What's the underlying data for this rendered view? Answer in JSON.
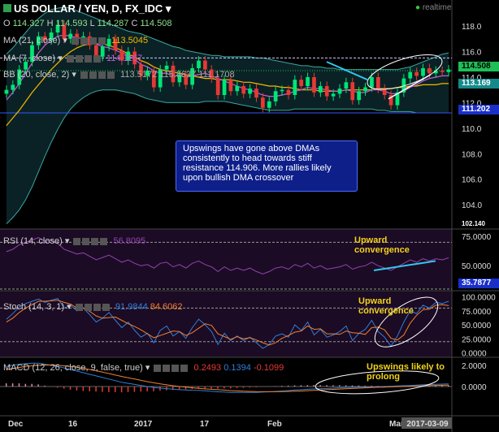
{
  "header": {
    "symbol": "US DOLLAR / YEN, D, FX_IDC",
    "realtime": "realtime",
    "ohlc": {
      "o_label": "O",
      "o": "114.327",
      "h_label": "H",
      "h": "114.593",
      "l_label": "L",
      "l": "114.287",
      "c_label": "C",
      "c": "114.508"
    },
    "ma21_label": "MA (21, close)",
    "ma21_value": "113.5045",
    "ma7_label": "MA (7, close)",
    "ma7_value": "114.1167",
    "bb_label": "BB (20, close, 2)",
    "bb_values": [
      "113.5172",
      "115.8637",
      "111.1708"
    ],
    "rsi_label": "RSI (14, close)",
    "rsi_value": "56.8095",
    "stoch_label": "Stoch (14, 3, 1)",
    "stoch_values": [
      "91.9844",
      "84.6062"
    ],
    "macd_label": "MACD (12, 26, close, 9, false, true)",
    "macd_values": [
      "0.2493",
      "0.1394",
      "-0.1099"
    ]
  },
  "callout": "Upswings have gone above DMAs consistently to head towards stiff resistance 114.906. More rallies likely upon bullish DMA crossover",
  "annotations": {
    "rsi": [
      "Upward",
      "convergence"
    ],
    "stoch": [
      "Upward",
      "convergence"
    ],
    "macd": [
      "Upswings likely to",
      "prolong"
    ]
  },
  "price_tags": {
    "last": "114.508",
    "bb_mid": "113.169",
    "support": "111.202",
    "upper_rsi": "35.7877",
    "top_cut": "102.140"
  },
  "colors": {
    "up": "#00e676",
    "down": "#e53935",
    "ma21": "#f5b800",
    "ma7": "#c85ad8",
    "bb": "#3aa6a0",
    "rsi": "#8e44ad",
    "stoch_k": "#2f7fd8",
    "stoch_d": "#f08030",
    "macd": "#2f7fd8",
    "signal": "#f08030",
    "callout_bg": "#0e1f8a",
    "annotation": "#f2d21b",
    "arrow": "#30c8f0"
  },
  "chart_data": [
    {
      "type": "candlestick",
      "title": "US DOLLAR / YEN, D, FX_IDC",
      "ylim": [
        102.1,
        118.9
      ],
      "yticks": [
        118.0,
        116.0,
        114.0,
        112.0,
        110.0,
        108.0,
        106.0,
        104.0
      ],
      "xticks": [
        "Dec",
        "16",
        "2017",
        "17",
        "Feb",
        "Mar",
        "2017-03-09"
      ],
      "close": [
        113.0,
        113.4,
        114.6,
        115.2,
        116.5,
        117.2,
        116.9,
        117.5,
        118.1,
        117.0,
        117.4,
        116.8,
        117.2,
        116.5,
        115.6,
        116.4,
        117.0,
        116.1,
        115.3,
        116.0,
        115.0,
        114.1,
        114.5,
        113.2,
        114.6,
        114.9,
        113.6,
        114.2,
        113.4,
        114.7,
        115.3,
        114.6,
        113.9,
        112.6,
        113.8,
        112.9,
        113.3,
        112.7,
        113.1,
        112.4,
        111.6,
        112.1,
        112.9,
        113.0,
        112.6,
        113.8,
        113.3,
        114.0,
        112.8,
        113.3,
        112.5,
        112.7,
        113.1,
        113.6,
        112.2,
        112.9,
        113.2,
        114.0,
        113.1,
        112.6,
        111.8,
        112.8,
        113.9,
        114.4,
        114.1,
        114.7,
        114.3,
        114.5,
        114.4,
        114.6
      ],
      "ma21": [
        110.2,
        110.8,
        111.4,
        112.1,
        112.8,
        113.4,
        114.0,
        114.6,
        115.1,
        115.6,
        116.0,
        116.3,
        116.5,
        116.6,
        116.6,
        116.6,
        116.5,
        116.3,
        116.1,
        115.8,
        115.6,
        115.3,
        115.1,
        114.8,
        114.6,
        114.5,
        114.4,
        114.3,
        114.2,
        114.1,
        114.0,
        113.9,
        113.9,
        113.8,
        113.8,
        113.8,
        113.7,
        113.6,
        113.6,
        113.5,
        113.4,
        113.3,
        113.3,
        113.2,
        113.2,
        113.1,
        113.0,
        113.0,
        113.0,
        112.9,
        112.9,
        112.9,
        112.9,
        113.0,
        113.0,
        113.0,
        113.0,
        113.0,
        113.1,
        113.1,
        113.1,
        113.2,
        113.2,
        113.3,
        113.3,
        113.4,
        113.4,
        113.4,
        113.5,
        113.5
      ],
      "ma7": [
        112.2,
        112.8,
        113.5,
        114.3,
        115.1,
        115.9,
        116.5,
        116.9,
        117.2,
        117.3,
        117.2,
        117.1,
        117.0,
        116.9,
        116.6,
        116.4,
        116.3,
        116.1,
        115.9,
        115.7,
        115.4,
        115.0,
        114.8,
        114.5,
        114.3,
        114.3,
        114.1,
        114.1,
        114.0,
        114.1,
        114.2,
        114.3,
        114.1,
        113.9,
        113.7,
        113.5,
        113.3,
        113.1,
        113.0,
        112.8,
        112.6,
        112.5,
        112.5,
        112.6,
        112.7,
        112.9,
        113.0,
        113.2,
        113.1,
        113.1,
        113.0,
        112.9,
        112.9,
        113.0,
        112.9,
        112.8,
        112.8,
        113.0,
        113.0,
        112.9,
        112.7,
        112.7,
        112.9,
        113.2,
        113.4,
        113.7,
        113.9,
        114.0,
        114.1,
        114.1
      ],
      "bb_upper": [
        115.8,
        116.3,
        116.9,
        117.5,
        118.1,
        118.6,
        119.0,
        119.3,
        119.4,
        119.5,
        119.4,
        119.2,
        119.0,
        118.8,
        118.6,
        118.4,
        118.2,
        118.0,
        117.8,
        117.6,
        117.5,
        117.4,
        117.2,
        117.0,
        116.8,
        116.6,
        116.4,
        116.3,
        116.1,
        116.0,
        115.9,
        115.8,
        115.7,
        115.7,
        115.6,
        115.6,
        115.6,
        115.6,
        115.6,
        115.5,
        115.5,
        115.4,
        115.3,
        115.2,
        115.1,
        115.0,
        114.9,
        114.9,
        114.8,
        114.8,
        114.7,
        114.7,
        114.6,
        114.6,
        114.6,
        114.6,
        114.6,
        114.6,
        114.6,
        114.6,
        114.6,
        114.6,
        114.7,
        114.8,
        115.0,
        115.2,
        115.4,
        115.6,
        115.8,
        115.9
      ],
      "bb_lower": [
        102.5,
        103.0,
        103.6,
        104.4,
        105.4,
        106.6,
        107.8,
        108.9,
        109.9,
        110.8,
        111.5,
        112.0,
        112.4,
        112.7,
        112.9,
        113.0,
        113.0,
        113.0,
        112.9,
        112.8,
        112.7,
        112.5,
        112.3,
        112.2,
        112.1,
        112.0,
        112.0,
        112.0,
        112.0,
        112.0,
        112.0,
        112.1,
        112.1,
        112.1,
        112.1,
        112.0,
        111.9,
        111.8,
        111.7,
        111.6,
        111.5,
        111.4,
        111.4,
        111.4,
        111.4,
        111.5,
        111.5,
        111.5,
        111.5,
        111.5,
        111.5,
        111.5,
        111.5,
        111.5,
        111.5,
        111.5,
        111.5,
        111.5,
        111.4,
        111.4,
        111.3,
        111.3,
        111.3,
        111.3,
        111.2,
        111.2,
        111.2,
        111.2,
        111.2,
        111.2
      ],
      "support": 111.202
    },
    {
      "type": "line",
      "title": "RSI (14, close)",
      "ylim": [
        30,
        80
      ],
      "yticks": [
        75.0,
        50.0
      ],
      "levels": [
        70,
        30
      ],
      "values": [
        62,
        64,
        68,
        70,
        72,
        74,
        71,
        72,
        69,
        64,
        62,
        60,
        61,
        58,
        55,
        57,
        59,
        56,
        53,
        55,
        52,
        50,
        51,
        48,
        52,
        53,
        49,
        51,
        48,
        52,
        54,
        51,
        49,
        45,
        49,
        46,
        48,
        46,
        48,
        45,
        43,
        45,
        48,
        49,
        47,
        51,
        49,
        52,
        48,
        50,
        47,
        48,
        49,
        51,
        47,
        49,
        50,
        53,
        50,
        48,
        46,
        49,
        52,
        55,
        53,
        56,
        54,
        56,
        55,
        56.8
      ]
    },
    {
      "type": "line",
      "title": "Stoch (14, 3, 1)",
      "ylim": [
        -5,
        108
      ],
      "yticks": [
        100.0,
        75.0,
        50.0,
        25.0,
        0.0
      ],
      "levels": [
        80,
        20
      ],
      "series": [
        {
          "values": [
            60,
            70,
            82,
            88,
            92,
            96,
            90,
            94,
            97,
            80,
            85,
            75,
            80,
            68,
            55,
            62,
            72,
            58,
            45,
            55,
            40,
            28,
            35,
            18,
            40,
            48,
            30,
            38,
            26,
            45,
            60,
            50,
            38,
            15,
            35,
            22,
            30,
            22,
            28,
            18,
            8,
            15,
            30,
            34,
            28,
            50,
            40,
            55,
            32,
            42,
            28,
            32,
            38,
            48,
            22,
            35,
            42,
            58,
            38,
            28,
            12,
            30,
            55,
            75,
            70,
            85,
            80,
            90,
            88,
            92
          ]
        },
        {
          "values": [
            55,
            62,
            72,
            80,
            86,
            92,
            92,
            93,
            94,
            90,
            87,
            80,
            80,
            74,
            66,
            62,
            63,
            64,
            58,
            52,
            47,
            41,
            34,
            27,
            31,
            35,
            39,
            38,
            31,
            36,
            44,
            52,
            49,
            34,
            29,
            24,
            29,
            25,
            27,
            23,
            18,
            14,
            18,
            26,
            31,
            37,
            39,
            48,
            42,
            43,
            34,
            34,
            33,
            39,
            36,
            35,
            33,
            45,
            46,
            41,
            26,
            23,
            32,
            53,
            67,
            77,
            78,
            85,
            86,
            84.6
          ]
        }
      ]
    },
    {
      "type": "bar",
      "title": "MACD (12, 26, close, 9, false, true)",
      "ylim": [
        -2.6,
        2.6
      ],
      "yticks": [
        2.0,
        0.0
      ],
      "macd": [
        1.9,
        2.0,
        2.1,
        2.15,
        2.2,
        2.2,
        2.1,
        2.0,
        1.9,
        1.75,
        1.6,
        1.45,
        1.3,
        1.15,
        1.0,
        0.85,
        0.7,
        0.55,
        0.4,
        0.3,
        0.2,
        0.1,
        0.0,
        -0.1,
        -0.15,
        -0.2,
        -0.25,
        -0.3,
        -0.32,
        -0.35,
        -0.37,
        -0.4,
        -0.45,
        -0.5,
        -0.52,
        -0.55,
        -0.55,
        -0.56,
        -0.55,
        -0.55,
        -0.52,
        -0.5,
        -0.46,
        -0.42,
        -0.38,
        -0.33,
        -0.3,
        -0.26,
        -0.22,
        -0.2,
        -0.18,
        -0.15,
        -0.12,
        -0.1,
        -0.08,
        -0.06,
        -0.05,
        -0.03,
        -0.01,
        0.0,
        0.02,
        0.05,
        0.08,
        0.1,
        0.13,
        0.16,
        0.19,
        0.21,
        0.23,
        0.2493
      ],
      "signal": [
        1.6,
        1.7,
        1.8,
        1.9,
        1.95,
        2.0,
        2.02,
        2.03,
        2.0,
        1.95,
        1.9,
        1.82,
        1.72,
        1.6,
        1.48,
        1.35,
        1.22,
        1.08,
        0.95,
        0.82,
        0.7,
        0.58,
        0.46,
        0.35,
        0.25,
        0.16,
        0.08,
        0.0,
        -0.06,
        -0.12,
        -0.17,
        -0.22,
        -0.26,
        -0.3,
        -0.34,
        -0.38,
        -0.41,
        -0.44,
        -0.46,
        -0.48,
        -0.49,
        -0.49,
        -0.49,
        -0.48,
        -0.46,
        -0.44,
        -0.42,
        -0.39,
        -0.36,
        -0.33,
        -0.3,
        -0.27,
        -0.24,
        -0.21,
        -0.18,
        -0.15,
        -0.12,
        -0.1,
        -0.07,
        -0.05,
        -0.03,
        -0.01,
        0.01,
        0.03,
        0.05,
        0.07,
        0.09,
        0.11,
        0.125,
        0.1394
      ],
      "histogram": [
        0.3,
        0.3,
        0.3,
        0.25,
        0.25,
        0.2,
        0.08,
        -0.03,
        -0.1,
        -0.2,
        -0.3,
        -0.37,
        -0.42,
        -0.45,
        -0.48,
        -0.5,
        -0.52,
        -0.53,
        -0.55,
        -0.52,
        -0.5,
        -0.48,
        -0.46,
        -0.45,
        -0.4,
        -0.36,
        -0.33,
        -0.3,
        -0.26,
        -0.23,
        -0.2,
        -0.18,
        -0.19,
        -0.2,
        -0.18,
        -0.17,
        -0.14,
        -0.12,
        -0.09,
        -0.07,
        -0.03,
        -0.01,
        0.03,
        0.06,
        0.08,
        0.11,
        0.12,
        0.13,
        0.14,
        0.13,
        0.12,
        0.12,
        0.12,
        0.11,
        0.1,
        0.09,
        0.07,
        0.07,
        0.06,
        0.05,
        0.05,
        0.06,
        0.07,
        0.07,
        0.08,
        0.09,
        0.1,
        0.1,
        0.105,
        0.1099
      ]
    }
  ]
}
